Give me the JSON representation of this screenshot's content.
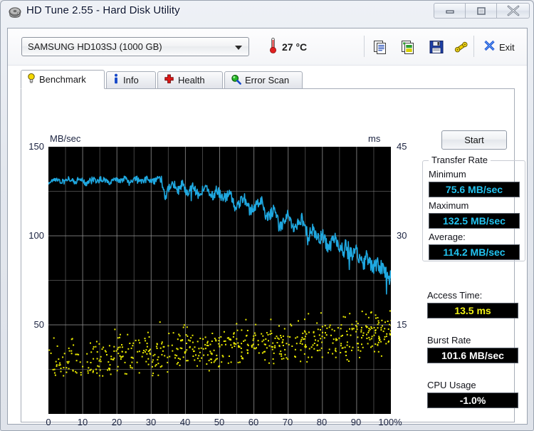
{
  "window": {
    "title": "HD Tune 2.55 - Hard Disk Utility",
    "icon": "hard-disk-icon",
    "controls": {
      "minimize": "minimize",
      "maximize": "maximize",
      "close": "close"
    }
  },
  "toolbar": {
    "drive_selected": "SAMSUNG HD103SJ (1000 GB)",
    "drive_options": [
      "SAMSUNG HD103SJ (1000 GB)"
    ],
    "temperature": "27 °C",
    "temperature_icon": "thermometer-icon",
    "icons": [
      {
        "name": "copy-text-icon",
        "title": "Copy text"
      },
      {
        "name": "copy-image-icon",
        "title": "Copy image"
      },
      {
        "name": "save-icon",
        "title": "Save"
      },
      {
        "name": "settings-icon",
        "title": "Options"
      }
    ],
    "exit_label": "Exit",
    "exit_icon": "close-x-icon"
  },
  "tabs": [
    {
      "label": "Benchmark",
      "icon": "lightbulb-icon",
      "active": true
    },
    {
      "label": "Info",
      "icon": "info-icon",
      "active": false
    },
    {
      "label": "Health",
      "icon": "red-cross-icon",
      "active": false
    },
    {
      "label": "Error Scan",
      "icon": "magnifier-icon",
      "active": false
    }
  ],
  "benchmark": {
    "start_label": "Start",
    "transfer_rate": {
      "group_title": "Transfer Rate",
      "minimum_label": "Minimum",
      "minimum_value": "75.6 MB/sec",
      "maximum_label": "Maximum",
      "maximum_value": "132.5 MB/sec",
      "average_label": "Average:",
      "average_value": "114.2 MB/sec"
    },
    "access_time_label": "Access Time:",
    "access_time_value": "13.5 ms",
    "burst_rate_label": "Burst Rate",
    "burst_rate_value": "101.6 MB/sec",
    "cpu_usage_label": "CPU Usage",
    "cpu_usage_value": "-1.0%"
  },
  "colors": {
    "transfer_curve": "#1fa8e0",
    "access_points": "#e8e800",
    "plot_background": "#000000",
    "grid": "#8a8a8a",
    "value_cyan": "#22c3f0",
    "value_yellow": "#f2f215",
    "value_white": "#ffffff"
  },
  "chart_data": {
    "type": "line",
    "title": "",
    "xlabel": "",
    "ylabel": "MB/sec",
    "ylabel_right": "ms",
    "xlim": [
      0,
      100
    ],
    "ylim": [
      0,
      150
    ],
    "ylim_right": [
      0,
      45
    ],
    "grid": true,
    "legend": "none",
    "xticks": [
      0,
      10,
      20,
      30,
      40,
      50,
      60,
      70,
      80,
      90,
      100
    ],
    "xticklabels": [
      "0",
      "10",
      "20",
      "30",
      "40",
      "50",
      "60",
      "70",
      "80",
      "90",
      "100%"
    ],
    "yticks_left": [
      50,
      100,
      150
    ],
    "yticklabels_left": [
      "50",
      "100",
      "150"
    ],
    "yticks_right": [
      15,
      30,
      45
    ],
    "yticklabels_right": [
      "15",
      "30",
      "45"
    ],
    "series": [
      {
        "name": "Transfer rate",
        "axis": "left",
        "units": "MB/sec",
        "color": "#1fa8e0",
        "x": [
          0,
          1,
          2,
          3,
          4,
          5,
          6,
          7,
          8,
          9,
          10,
          11,
          12,
          13,
          14,
          15,
          16,
          17,
          18,
          19,
          20,
          21,
          22,
          23,
          24,
          25,
          26,
          27,
          28,
          29,
          30,
          31,
          32,
          33,
          34,
          35,
          36,
          37,
          38,
          39,
          40,
          41,
          42,
          43,
          44,
          45,
          46,
          47,
          48,
          49,
          50,
          51,
          52,
          53,
          54,
          55,
          56,
          57,
          58,
          59,
          60,
          61,
          62,
          63,
          64,
          65,
          66,
          67,
          68,
          69,
          70,
          71,
          72,
          73,
          74,
          75,
          76,
          77,
          78,
          79,
          80,
          81,
          82,
          83,
          84,
          85,
          86,
          87,
          88,
          89,
          90,
          91,
          92,
          93,
          94,
          95,
          96,
          97,
          98,
          99,
          100
        ],
        "y": [
          129.5,
          131.0,
          131.5,
          131.0,
          130.5,
          131.5,
          132.0,
          131.0,
          130.0,
          132.5,
          131.5,
          129.0,
          131.0,
          132.0,
          130.5,
          131.5,
          132.0,
          131.0,
          130.0,
          132.0,
          131.5,
          130.5,
          132.0,
          131.0,
          129.5,
          131.5,
          132.0,
          130.5,
          131.0,
          132.0,
          131.5,
          130.0,
          131.5,
          132.0,
          121.0,
          126.0,
          130.0,
          128.5,
          125.0,
          129.5,
          126.0,
          123.5,
          128.0,
          125.0,
          122.0,
          126.5,
          128.0,
          124.0,
          122.5,
          126.0,
          124.0,
          120.5,
          122.0,
          124.5,
          118.0,
          115.0,
          119.0,
          122.5,
          117.0,
          113.5,
          116.0,
          118.5,
          121.0,
          114.0,
          110.5,
          112.0,
          115.5,
          108.0,
          104.5,
          109.0,
          112.0,
          106.0,
          102.5,
          107.0,
          109.5,
          103.0,
          99.5,
          104.0,
          101.0,
          97.5,
          100.5,
          96.0,
          93.0,
          97.5,
          99.0,
          94.5,
          91.0,
          95.5,
          92.0,
          88.5,
          91.5,
          87.0,
          84.5,
          88.0,
          85.0,
          82.0,
          85.5,
          83.0,
          79.5,
          78.0,
          76.5
        ]
      },
      {
        "name": "Access time",
        "axis": "right",
        "units": "ms",
        "color": "#e8e800",
        "description": "Scatter of random-access seek latency samples, roughly 8-20 ms, trending slightly upward across the disk",
        "mean": 13.5,
        "range": [
          6.5,
          21.0
        ],
        "point_count": 640
      }
    ]
  }
}
